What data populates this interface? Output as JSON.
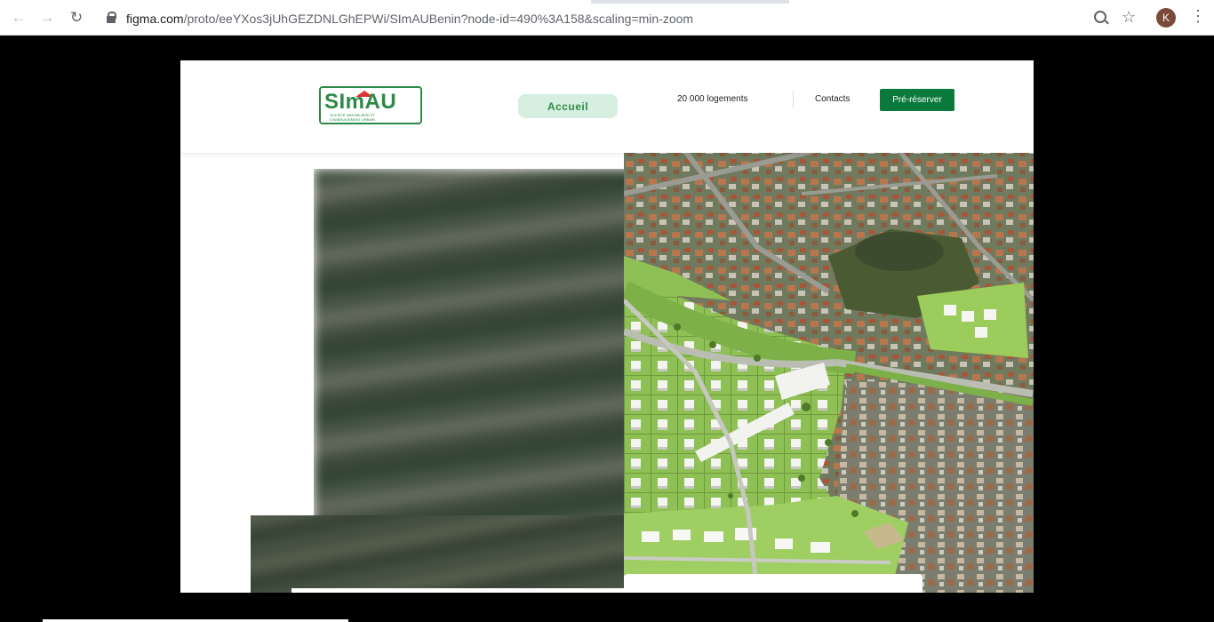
{
  "browser": {
    "url_domain": "figma.com",
    "url_path": "/proto/eeYXos3jUhGEZDNLGhEPWi/SImAUBenin?node-id=490%3A158&scaling=min-zoom",
    "avatar_initial": "K"
  },
  "site": {
    "logo": {
      "name": "SImAU",
      "tagline_line1": "SOCIÉTÉ IMMOBILIÈRE ET",
      "tagline_line2": "D'AMÉNAGEMENT URBAIN"
    },
    "nav": {
      "home": "Accueil",
      "housing": "20 000 logements",
      "contacts": "Contacts",
      "cta": "Pré-réserver"
    }
  },
  "colors": {
    "brand_green": "#2d8a46",
    "cta_green": "#0a7a3c",
    "accueil_bg": "#d6efe0"
  }
}
